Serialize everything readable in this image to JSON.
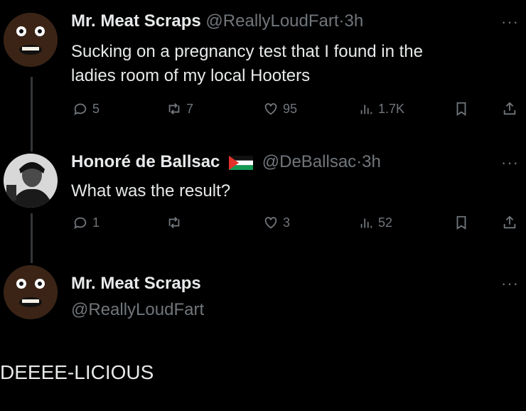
{
  "tweets": [
    {
      "name": "Mr. Meat Scraps",
      "handle": "@ReallyLoudFart",
      "time": "3h",
      "text_lines": [
        "Sucking on a pregnancy test that I found in the",
        "ladies room of my local Hooters"
      ],
      "replies": "5",
      "retweets": "7",
      "likes": "95",
      "views": "1.7K"
    },
    {
      "name": "Honoré de Ballsac",
      "handle": "@DeBallsac",
      "time": "3h",
      "text_lines": [
        "What was the result?"
      ],
      "replies": "1",
      "retweets": "",
      "likes": "3",
      "views": "52",
      "flag_icon": "palestine-flag-icon"
    },
    {
      "name": "Mr. Meat Scraps",
      "handle": "@ReallyLoudFart"
    }
  ],
  "reply_text": "DEEEE-LICIOUS",
  "separator": "·",
  "more_glyph": "···",
  "colors": {
    "background": "#000000",
    "text": "#e7e9ea",
    "muted": "#71767b"
  }
}
